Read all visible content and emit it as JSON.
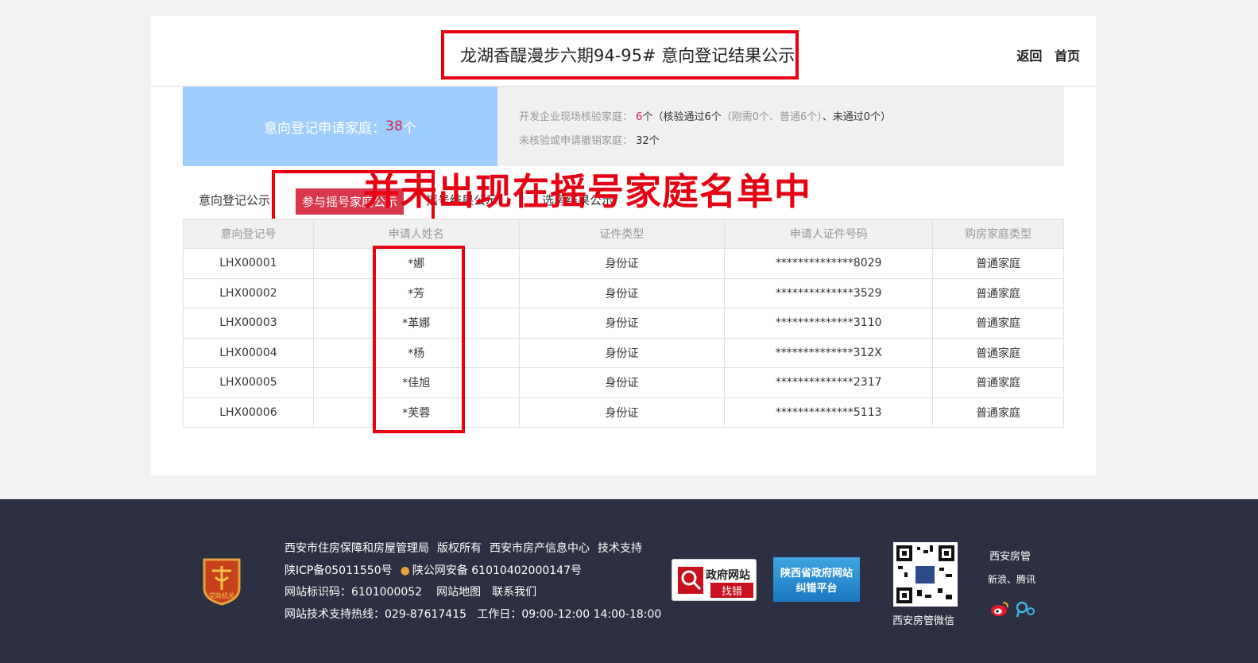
{
  "header": {
    "title": "龙湖香醍漫步六期94-95# 意向登记结果公示",
    "back_label": "返回",
    "home_label": "首页"
  },
  "summary": {
    "applicants_label": "意向登记申请家庭：",
    "applicants_count": "38",
    "applicants_unit": "个",
    "verified_label": "开发企业现场核验家庭：",
    "verified_count": "6",
    "verified_detail_prefix": "个（",
    "verified_pass": "核验通过6个",
    "verified_breakdown": "（刚需0个、普通6个）",
    "verified_sep": "、",
    "verified_fail": "未通过0个",
    "verified_suffix": "）",
    "unverified_label": "未核验或申请撤销家庭：",
    "unverified_value": "32个"
  },
  "tabs": [
    {
      "label": "意向登记公示"
    },
    {
      "label": "参与摇号家庭公示"
    },
    {
      "label": "摇号结果公示"
    },
    {
      "label": "选房结果公示"
    }
  ],
  "annotation": "并未出现在摇号家庭名单中",
  "table": {
    "headers": [
      "意向登记号",
      "申请人姓名",
      "证件类型",
      "申请人证件号码",
      "购房家庭类型"
    ],
    "rows": [
      [
        "LHX00001",
        "*娜",
        "身份证",
        "**************8029",
        "普通家庭"
      ],
      [
        "LHX00002",
        "*芳",
        "身份证",
        "**************3529",
        "普通家庭"
      ],
      [
        "LHX00003",
        "*革娜",
        "身份证",
        "**************3110",
        "普通家庭"
      ],
      [
        "LHX00004",
        "*杨",
        "身份证",
        "**************312X",
        "普通家庭"
      ],
      [
        "LHX00005",
        "*佳旭",
        "身份证",
        "**************2317",
        "普通家庭"
      ],
      [
        "LHX00006",
        "*芙蓉",
        "身份证",
        "**************5113",
        "普通家庭"
      ]
    ]
  },
  "footer": {
    "line1": [
      "西安市住房保障和房屋管理局",
      "版权所有",
      "西安市房产信息中心",
      "技术支持"
    ],
    "icp": "陕ICP备05011550号",
    "police": "陕公网安备 61010402000147号",
    "site_id": "网站标识码：6101000052",
    "sitemap": "网站地图",
    "contact": "联系我们",
    "hotline": "网站技术支持热线：029-87617415   工作日：09:00-12:00 14:00-18:00",
    "badge_text": "党政机关",
    "gov_btn_line1": "政府网站",
    "gov_btn_line2": "找错",
    "shaanxi_line1": "陕西省政府网站",
    "shaanxi_line2": "纠错平台",
    "qr_label": "西安房管微信",
    "social_title": "西安房管",
    "social_sub": "新浪、腾讯"
  },
  "colors": {
    "accent_red": "#e60012",
    "tab_active": "#d9374c",
    "summary_blue": "#9dcdfd",
    "footer_bg": "#2c3042"
  }
}
